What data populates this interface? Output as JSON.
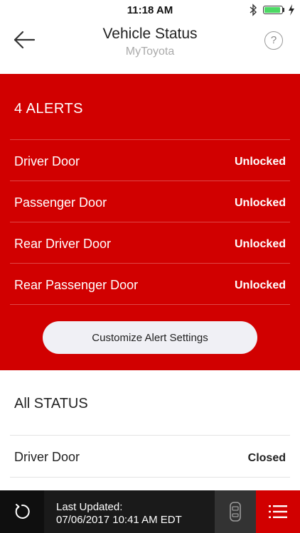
{
  "status_bar": {
    "time": "11:18 AM",
    "battery_fraction": 0.9,
    "icons": [
      "bluetooth-icon",
      "battery-icon",
      "charging-bolt-icon"
    ]
  },
  "header": {
    "title": "Vehicle Status",
    "subtitle": "MyToyota",
    "help_label": "?",
    "icons": [
      "back-arrow-icon",
      "help-icon"
    ]
  },
  "alerts": {
    "heading": "4 ALERTS",
    "items": [
      {
        "name": "Driver Door",
        "value": "Unlocked"
      },
      {
        "name": "Passenger Door",
        "value": "Unlocked"
      },
      {
        "name": "Rear Driver Door",
        "value": "Unlocked"
      },
      {
        "name": "Rear Passenger Door",
        "value": "Unlocked"
      }
    ],
    "button_label": "Customize Alert Settings"
  },
  "all_status": {
    "heading": "All STATUS",
    "items": [
      {
        "name": "Driver Door",
        "value": "Closed"
      }
    ]
  },
  "bottom_bar": {
    "updated_label": "Last Updated:",
    "updated_time": "07/06/2017 10:41 AM EDT",
    "icons": [
      "refresh-icon",
      "vehicle-icon",
      "list-icon"
    ]
  },
  "colors": {
    "accent": "#d10000",
    "bottom_bar": "#1a1a1a",
    "button_bg": "#f0f0f5"
  }
}
